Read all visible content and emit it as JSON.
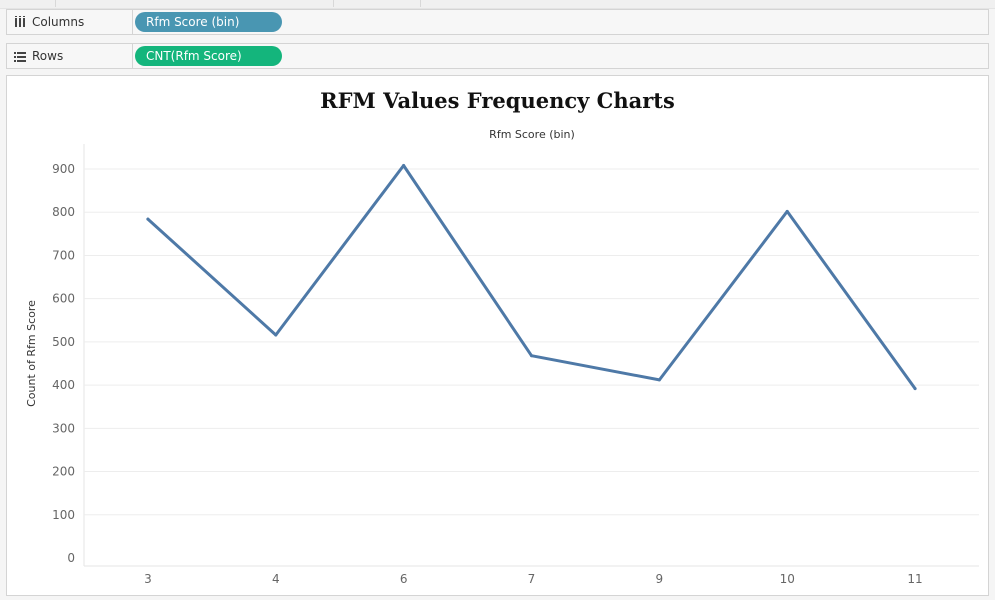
{
  "shelves": {
    "columns": {
      "label": "Columns",
      "pill": "Rfm Score (bin)",
      "pill_color": "#4996b2"
    },
    "rows": {
      "label": "Rows",
      "pill": "CNT(Rfm Score)",
      "pill_color": "#14b57c"
    }
  },
  "chart_data": {
    "type": "line",
    "title": "RFM Values Frequency Charts",
    "xlabel": "Rfm Score (bin)",
    "ylabel": "Count of Rfm Score",
    "categories": [
      "3",
      "4",
      "6",
      "7",
      "9",
      "10",
      "11"
    ],
    "values": [
      784,
      516,
      908,
      468,
      412,
      802,
      392
    ],
    "ylim": [
      0,
      900
    ],
    "yticks": [
      0,
      100,
      200,
      300,
      400,
      500,
      600,
      700,
      800,
      900
    ],
    "line_color": "#4e79a7",
    "grid": true,
    "legend": "none"
  }
}
